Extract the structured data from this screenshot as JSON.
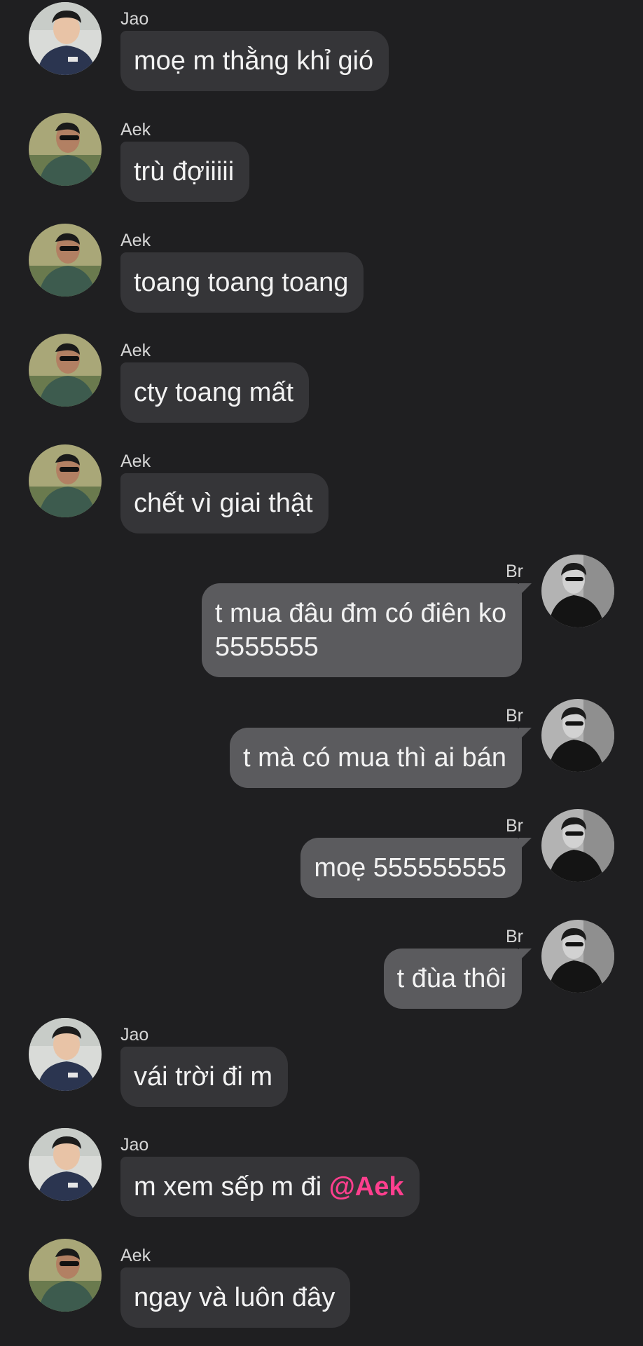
{
  "messages": [
    {
      "sender": "Jao",
      "avatar": "jao-avatar",
      "text": "moẹ m thằng khỉ gió",
      "direction": "in"
    },
    {
      "sender": "Aek",
      "avatar": "aek-avatar",
      "text": "trù đợiiiii",
      "direction": "in"
    },
    {
      "sender": "Aek",
      "avatar": "aek-avatar",
      "text": "toang toang toang",
      "direction": "in"
    },
    {
      "sender": "Aek",
      "avatar": "aek-avatar",
      "text": "cty toang mất",
      "direction": "in"
    },
    {
      "sender": "Aek",
      "avatar": "aek-avatar",
      "text": "chết vì giai thật",
      "direction": "in"
    },
    {
      "sender": "Br",
      "avatar": "br-avatar",
      "text": "t mua đâu đm có điên ko\n5555555",
      "direction": "out"
    },
    {
      "sender": "Br",
      "avatar": "br-avatar",
      "text": "t mà có mua thì ai bán",
      "direction": "out"
    },
    {
      "sender": "Br",
      "avatar": "br-avatar",
      "text": "moẹ 555555555",
      "direction": "out"
    },
    {
      "sender": "Br",
      "avatar": "br-avatar",
      "text": "t đùa thôi",
      "direction": "out"
    },
    {
      "sender": "Jao",
      "avatar": "jao-avatar",
      "text": "vái trời đi m",
      "direction": "in"
    },
    {
      "sender": "Jao",
      "avatar": "jao-avatar",
      "text": "m xem sếp m đi ",
      "mention": "@Aek",
      "direction": "in"
    },
    {
      "sender": "Aek",
      "avatar": "aek-avatar",
      "text": "ngay và luôn đây",
      "direction": "in"
    }
  ],
  "colors": {
    "background": "#1f1f21",
    "incoming_bubble": "#353538",
    "outgoing_bubble": "#5b5b5e",
    "mention": "#ff3f8e"
  }
}
